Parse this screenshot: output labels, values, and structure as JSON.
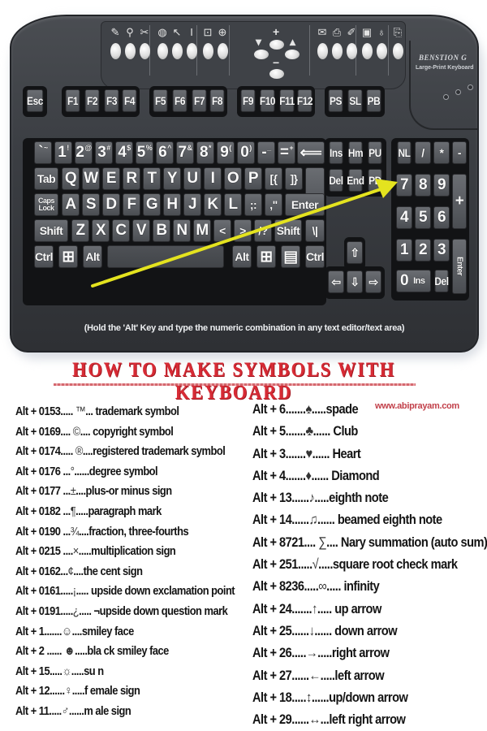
{
  "keyboard": {
    "brand": "BENSTION G",
    "brand_subtitle": "Large-Print Keyboard",
    "hotkey_glyphs": [
      "✎",
      "⚲",
      "✂",
      "◍",
      "↖",
      "I",
      "⊡",
      "⊕",
      "▾",
      "▴",
      "✉",
      "⎙",
      "✐",
      "▣",
      "♁",
      "⎘"
    ],
    "nav_plus": "+",
    "nav_minus": "−",
    "function_row": [
      "Esc",
      "F1",
      "F2",
      "F3",
      "F4",
      "F5",
      "F6",
      "F7",
      "F8",
      "F9",
      "F10",
      "F11",
      "F12",
      "PS",
      "SL",
      "PB"
    ],
    "number_row": [
      {
        "main": "`",
        "shift": "~"
      },
      {
        "main": "1",
        "shift": "!"
      },
      {
        "main": "2",
        "shift": "@"
      },
      {
        "main": "3",
        "shift": "#"
      },
      {
        "main": "4",
        "shift": "$"
      },
      {
        "main": "5",
        "shift": "%"
      },
      {
        "main": "6",
        "shift": "^"
      },
      {
        "main": "7",
        "shift": "&"
      },
      {
        "main": "8",
        "shift": "*"
      },
      {
        "main": "9",
        "shift": "("
      },
      {
        "main": "0",
        "shift": ")"
      },
      {
        "main": "-",
        "shift": "_"
      },
      {
        "main": "=",
        "shift": "+"
      }
    ],
    "backspace": "⟸",
    "tab": "Tab",
    "qwerty_row": [
      "Q",
      "W",
      "E",
      "R",
      "T",
      "Y",
      "U",
      "I",
      "O",
      "P",
      "[{",
      "]}"
    ],
    "caps": "Caps Lock",
    "home_row": [
      "A",
      "S",
      "D",
      "F",
      "G",
      "H",
      "J",
      "K",
      "L",
      ";:",
      ",\""
    ],
    "enter": "Enter",
    "shift_left": "Shift",
    "bottom_row": [
      "Z",
      "X",
      "C",
      "V",
      "B",
      "N",
      "M",
      "<",
      ">",
      "/?"
    ],
    "shift_right": "Shift",
    "backslash": "\\|",
    "ctrl_left": "Ctrl",
    "win_left": "⊞",
    "alt_left": "Alt",
    "alt_right": "Alt",
    "win_right": "⊞",
    "menu": "▤",
    "ctrl_right": "Ctrl",
    "edit_keys": [
      "Ins",
      "Hm",
      "PU",
      "Del",
      "End",
      "PD"
    ],
    "arrow_keys": {
      "up": "⇧",
      "left": "⇦",
      "down": "⇩",
      "right": "⇨"
    },
    "numpad": {
      "top": [
        "NL",
        "/",
        "*",
        "-"
      ],
      "row1": [
        "7",
        "8",
        "9"
      ],
      "plus": "+",
      "row2": [
        "4",
        "5",
        "6"
      ],
      "row3": [
        "1",
        "2",
        "3"
      ],
      "enter": "Enter",
      "zero": "0",
      "zero_sub": "Ins",
      "del": "Del"
    },
    "caption": "(Hold the 'Alt' Key and type the numeric combination in any text editor/text area)",
    "arrow_color": "#e4e31f"
  },
  "heading": "HOW TO MAKE SYMBOLS WITH KEYBOARD",
  "heading_color": "#d72b35",
  "website": "www.abiprayam.com",
  "left_list": [
    {
      "code": "Alt + 0153..... ",
      "symbol": "™",
      "desc": "... trademark symbol"
    },
    {
      "code": "Alt + 0169.... ",
      "symbol": "©",
      "desc": ".... copyright symbol"
    },
    {
      "code": "Alt + 0174..... ",
      "symbol": "®",
      "desc": "....registered  trademark symbol"
    },
    {
      "code": "Alt + 0176 ...",
      "symbol": "°",
      "desc": "......degree symbol"
    },
    {
      "code": "Alt + 0177 ...",
      "symbol": "±",
      "desc": "....plus-or minus sign"
    },
    {
      "code": "Alt + 0182 ...",
      "symbol": "¶",
      "desc": ".....paragraph mark"
    },
    {
      "code": "Alt + 0190 ...",
      "symbol": "¾",
      "desc": "....fraction, three-fourths"
    },
    {
      "code": "Alt + 0215 ....",
      "symbol": "×",
      "desc": ".....multiplication sign"
    },
    {
      "code": "Alt + 0162...",
      "symbol": "¢",
      "desc": "....the cent sign"
    },
    {
      "code": "Alt + 0161.....",
      "symbol": "¡",
      "desc": "..... upside down exclamation point"
    },
    {
      "code": "Alt + 0191.....",
      "symbol": "¿",
      "desc": "..... ¬upside down question mark"
    },
    {
      "code": "Alt + 1.......",
      "symbol": "☺",
      "desc": "....smiley face"
    },
    {
      "code": "Alt + 2 ...... ",
      "symbol": "☻",
      "desc": ".....bla ck smiley face"
    },
    {
      "code": "Alt + 15.....",
      "symbol": "☼",
      "desc": ".....su n"
    },
    {
      "code": "Alt + 12......",
      "symbol": "♀",
      "desc": ".....f emale sign"
    },
    {
      "code": "Alt + 11.....",
      "symbol": "♂",
      "desc": "......m ale sign"
    }
  ],
  "right_list": [
    {
      "code": "Alt + 6.......",
      "symbol": "♠",
      "desc": ".....spade"
    },
    {
      "code": "Alt + 5.......",
      "symbol": "♣",
      "desc": "...... Club"
    },
    {
      "code": "Alt + 3.......",
      "symbol": "♥",
      "desc": "...... Heart"
    },
    {
      "code": "Alt + 4.......",
      "symbol": "♦",
      "desc": "...... Diamond"
    },
    {
      "code": "Alt + 13......",
      "symbol": "♪",
      "desc": ".....eighth note"
    },
    {
      "code": "Alt + 14......",
      "symbol": "♫",
      "desc": "...... beamed eighth note"
    },
    {
      "code": "Alt + 8721.... ",
      "symbol": "∑",
      "desc": ".... Nary summation (auto sum)"
    },
    {
      "code": "Alt + 251.....",
      "symbol": "√",
      "desc": ".....square root check mark"
    },
    {
      "code": "Alt + 8236.....",
      "symbol": "∞",
      "desc": "..... infinity"
    },
    {
      "code": "Alt + 24.......",
      "symbol": "↑",
      "desc": "..... up arrow"
    },
    {
      "code": "Alt + 25......",
      "symbol": "↓",
      "desc": "...... down arrow"
    },
    {
      "code": "Alt + 26.....",
      "symbol": "→",
      "desc": ".....right arrow"
    },
    {
      "code": "Alt + 27......",
      "symbol": "←",
      "desc": ".....left arrow"
    },
    {
      "code": "Alt + 18.....",
      "symbol": "↕",
      "desc": "......up/down arrow"
    },
    {
      "code": "Alt + 29......",
      "symbol": "↔",
      "desc": "...left right arrow"
    }
  ]
}
